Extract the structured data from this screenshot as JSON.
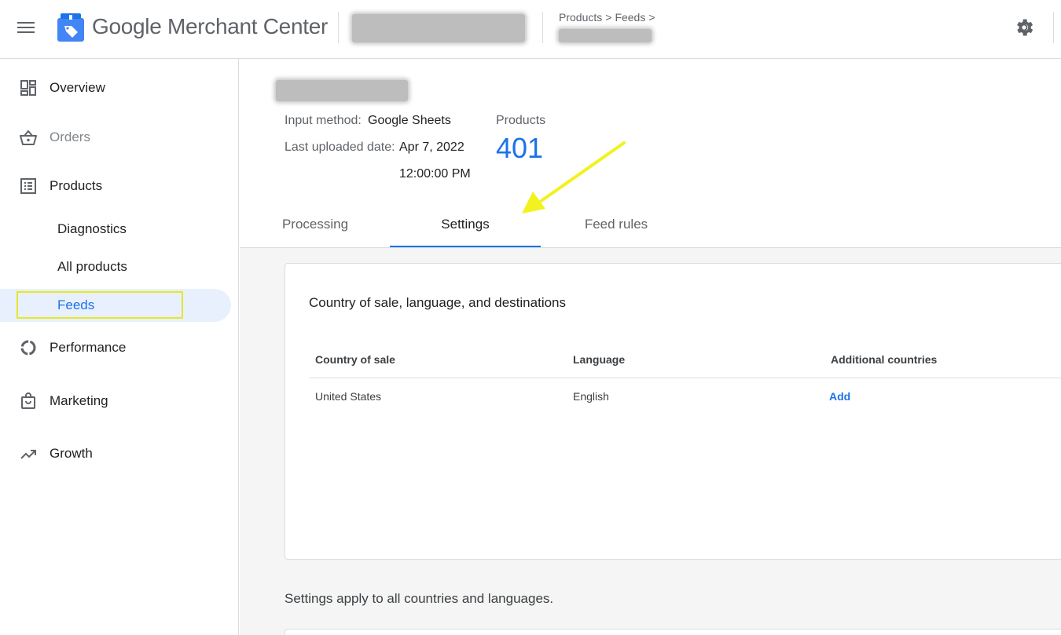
{
  "header": {
    "app_name": "Google Merchant Center",
    "breadcrumb": [
      "Products",
      "Feeds"
    ]
  },
  "sidebar": {
    "items": [
      {
        "label": "Overview",
        "icon": "dashboard-icon"
      },
      {
        "label": "Orders",
        "icon": "basket-icon"
      },
      {
        "label": "Products",
        "icon": "list-icon"
      },
      {
        "label": "Performance",
        "icon": "donut-icon"
      },
      {
        "label": "Marketing",
        "icon": "shopping-bag-icon"
      },
      {
        "label": "Growth",
        "icon": "trending-up-icon"
      }
    ],
    "sub_items": [
      {
        "label": "Diagnostics"
      },
      {
        "label": "All products"
      },
      {
        "label": "Feeds"
      }
    ]
  },
  "feed": {
    "input_method_label": "Input method:",
    "input_method_value": "Google Sheets",
    "last_uploaded_label": "Last uploaded date:",
    "last_uploaded_date": "Apr 7, 2022",
    "last_uploaded_time": "12:00:00 PM",
    "products_label": "Products",
    "products_count": "401"
  },
  "tabs": [
    {
      "label": "Processing"
    },
    {
      "label": "Settings"
    },
    {
      "label": "Feed rules"
    }
  ],
  "card": {
    "title": "Country of sale, language, and destinations",
    "columns": [
      "Country of sale",
      "Language",
      "Additional countries"
    ],
    "row": {
      "country": "United States",
      "language": "English",
      "action": "Add"
    }
  },
  "settings_note": "Settings apply to all countries and languages.",
  "colors": {
    "accent": "#1a73e8",
    "highlight": "#f2f21f",
    "active_bg": "#e8f0fe"
  }
}
